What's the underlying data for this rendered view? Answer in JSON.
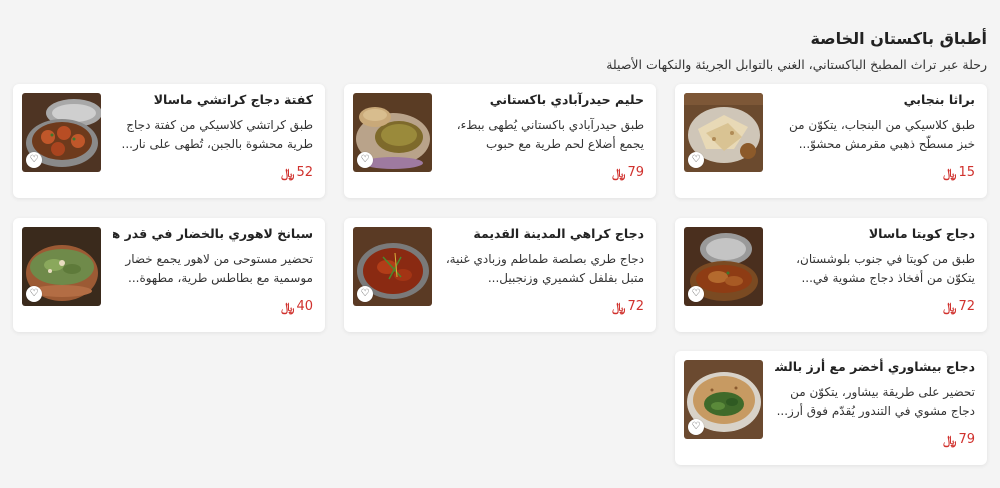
{
  "section": {
    "title": "أطباق باكستان الخاصة",
    "subtitle": "رحلة عبر تراث المطبخ الباكستاني، الغني بالتوابل الجريئة والنكهات الأصيلة"
  },
  "currency_symbol": "﷼",
  "dishes": [
    {
      "name": "براثا بنجابي",
      "desc": "طبق كلاسيكي من البنجاب، يتكوّن من خبز مسطّح ذهبي مقرمش محشوّ...",
      "price": "15"
    },
    {
      "name": "حليم حيدرآبادي باكستاني",
      "desc": "طبق حيدرآبادي باكستاني يُطهى ببطء، يجمع أضلاع لحم طرية مع حبوب مغذي...",
      "price": "79"
    },
    {
      "name": "كفتة دجاج كراتشي ماسالا",
      "desc": "طبق كراتشي كلاسيكي من كفتة دجاج طرية محشوة بالجبن، تُطهى على نار...",
      "price": "52"
    },
    {
      "name": "دجاج كويتا ماسالا",
      "desc": "طبق من كويتا في جنوب بلوشستان، يتكوّن من أفخاذ دجاج مشوية في...",
      "price": "72"
    },
    {
      "name": "دجاج كراهي المدينة القديمة",
      "desc": "دجاج طري بصلصة طماطم وزبادي غنية، متبل بفلفل كشميري وزنجبيل...",
      "price": "72"
    },
    {
      "name": "سبانخ لاهوري بالخضار في قدر هاندي",
      "desc": "تحضير مستوحى من لاهور يجمع خضار موسمية مع بطاطس طرية، مطهوة...",
      "price": "40"
    },
    {
      "name": "دجاج بيشاوري أخضر مع أرز بالشعيرية",
      "desc": "تحضير على طريقة بيشاور، يتكوّن من دجاج مشوي في التندور يُقدّم فوق أرز...",
      "price": "79"
    }
  ]
}
